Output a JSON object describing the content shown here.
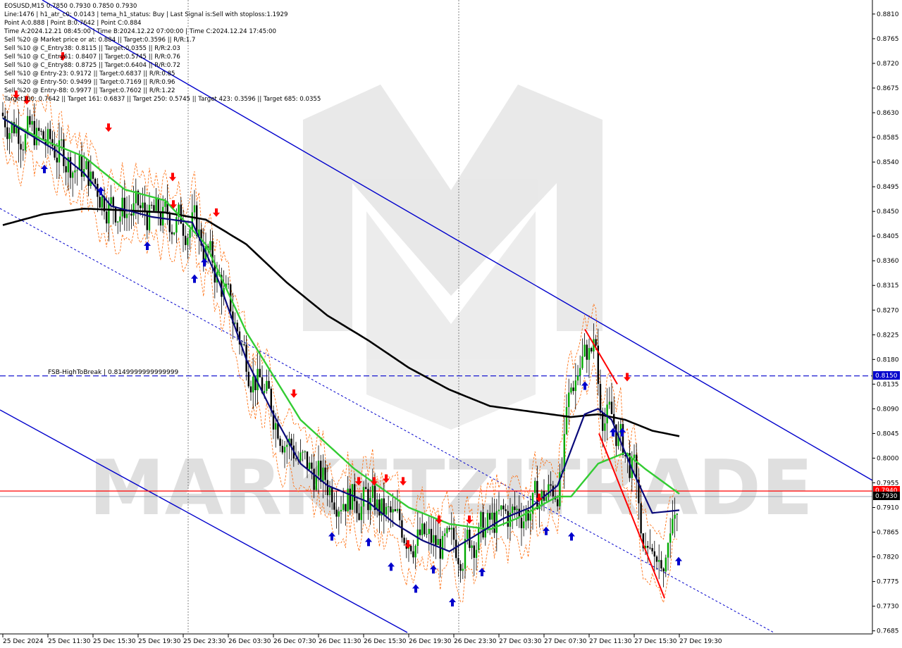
{
  "info": {
    "lines": [
      "EOSUSD,M15  0.7850 0.7930 0.7850 0.7930",
      "Line:1476 | h1_atr_c0: 0.0143 | tema_h1_status: Buy | Last Signal is:Sell with stoploss:1.1929",
      "Point A:0.888 | Point B:0.7642 | Point C:0.884",
      "Time A:2024.12.21 08:45:00 | Time B:2024.12.22 07:00:00 | Time C:2024.12.24 17:45:00",
      "Sell %20 @ Market price or at: 0.884 || Target:0.3596 || R/R:1.7",
      "Sell %10 @ C_Entry38: 0.8115 || Target:0.0355 || R/R:2.03",
      "Sell %10 @ C_Entry61: 0.8407 || Target:0.5745 || R/R:0.76",
      "Sell %10 @ C_Entry88: 0.8725 || Target:0.6404 || R/R:0.72",
      "Sell %10 @ Entry-23: 0.9172 || Target:0.6837 || R/R:0.85",
      "Sell %20 @ Entry-50: 0.9499 || Target:0.7169 || R/R:0.96",
      "Sell %20 @ Entry-88: 0.9977 || Target:0.7602 || R/R:1.22",
      "Target100: 0.7642 || Target 161: 0.6837 || Target 250: 0.5745 || Target 423: 0.3596 || Target 685: 0.0355"
    ]
  },
  "hline_label": "FSB-HighToBreak | 0.8149999999999999",
  "price_tags": {
    "level_blue": "0.8150",
    "level_red": "0.7940",
    "last": "0.7930"
  },
  "watermark": "MARKETZITRADE",
  "colors": {
    "red": "#ff0000",
    "blue": "#0000cc",
    "green": "#33cc33",
    "navy": "#0a0a7a",
    "black": "#000000",
    "orange": "#ff6600"
  },
  "chart_data": {
    "type": "candlestick",
    "symbol": "EOSUSD,M15",
    "yaxis": {
      "ticks": [
        "0.8810",
        "0.8765",
        "0.8720",
        "0.8675",
        "0.8630",
        "0.8585",
        "0.8540",
        "0.8495",
        "0.8450",
        "0.8405",
        "0.8360",
        "0.8315",
        "0.8270",
        "0.8225",
        "0.8180",
        "0.8135",
        "0.8090",
        "0.8045",
        "0.8000",
        "0.7955",
        "0.7910",
        "0.7865",
        "0.7820",
        "0.7775",
        "0.7730",
        "0.7685"
      ],
      "range": [
        0.7682,
        0.8833
      ]
    },
    "xaxis": {
      "ticks": [
        "25 Dec 2024",
        "25 Dec 11:30",
        "25 Dec 15:30",
        "25 Dec 19:30",
        "25 Dec 23:30",
        "26 Dec 03:30",
        "26 Dec 07:30",
        "26 Dec 11:30",
        "26 Dec 15:30",
        "26 Dec 19:30",
        "26 Dec 23:30",
        "27 Dec 03:30",
        "27 Dec 07:30",
        "27 Dec 11:30",
        "27 Dec 15:30",
        "27 Dec 19:30"
      ]
    },
    "levels": {
      "fsb_high_to_break": 0.815,
      "red_level": 0.794,
      "last_price": 0.793
    },
    "guide_points": [
      {
        "name": "ema_green",
        "pts": [
          [
            0,
            0.862
          ],
          [
            0.06,
            0.858
          ],
          [
            0.12,
            0.855
          ],
          [
            0.18,
            0.849
          ],
          [
            0.24,
            0.847
          ],
          [
            0.3,
            0.839
          ],
          [
            0.36,
            0.823
          ],
          [
            0.44,
            0.807
          ],
          [
            0.52,
            0.798
          ],
          [
            0.6,
            0.791
          ],
          [
            0.66,
            0.788
          ],
          [
            0.72,
            0.787
          ],
          [
            0.76,
            0.789
          ],
          [
            0.82,
            0.793
          ],
          [
            0.84,
            0.793
          ],
          [
            0.88,
            0.799
          ],
          [
            0.92,
            0.801
          ],
          [
            0.95,
            0.798
          ],
          [
            1,
            0.7935
          ]
        ]
      },
      {
        "name": "ema_navy",
        "pts": [
          [
            0,
            0.862
          ],
          [
            0.04,
            0.859
          ],
          [
            0.08,
            0.856
          ],
          [
            0.12,
            0.852
          ],
          [
            0.16,
            0.846
          ],
          [
            0.22,
            0.844
          ],
          [
            0.28,
            0.843
          ],
          [
            0.32,
            0.832
          ],
          [
            0.36,
            0.818
          ],
          [
            0.4,
            0.808
          ],
          [
            0.44,
            0.799
          ],
          [
            0.48,
            0.795
          ],
          [
            0.54,
            0.792
          ],
          [
            0.58,
            0.788
          ],
          [
            0.62,
            0.785
          ],
          [
            0.66,
            0.783
          ],
          [
            0.7,
            0.786
          ],
          [
            0.74,
            0.789
          ],
          [
            0.78,
            0.791
          ],
          [
            0.82,
            0.795
          ],
          [
            0.86,
            0.808
          ],
          [
            0.88,
            0.809
          ],
          [
            0.9,
            0.807
          ],
          [
            0.93,
            0.798
          ],
          [
            0.96,
            0.79
          ],
          [
            1,
            0.7905
          ]
        ]
      },
      {
        "name": "ma_black",
        "pts": [
          [
            0,
            0.8425
          ],
          [
            0.06,
            0.8445
          ],
          [
            0.12,
            0.8455
          ],
          [
            0.18,
            0.8452
          ],
          [
            0.24,
            0.8448
          ],
          [
            0.3,
            0.8435
          ],
          [
            0.36,
            0.839
          ],
          [
            0.42,
            0.832
          ],
          [
            0.48,
            0.826
          ],
          [
            0.54,
            0.8215
          ],
          [
            0.6,
            0.8165
          ],
          [
            0.66,
            0.8125
          ],
          [
            0.72,
            0.8095
          ],
          [
            0.78,
            0.8085
          ],
          [
            0.84,
            0.8075
          ],
          [
            0.88,
            0.808
          ],
          [
            0.92,
            0.807
          ],
          [
            0.96,
            0.805
          ],
          [
            1,
            0.804
          ]
        ]
      }
    ]
  }
}
